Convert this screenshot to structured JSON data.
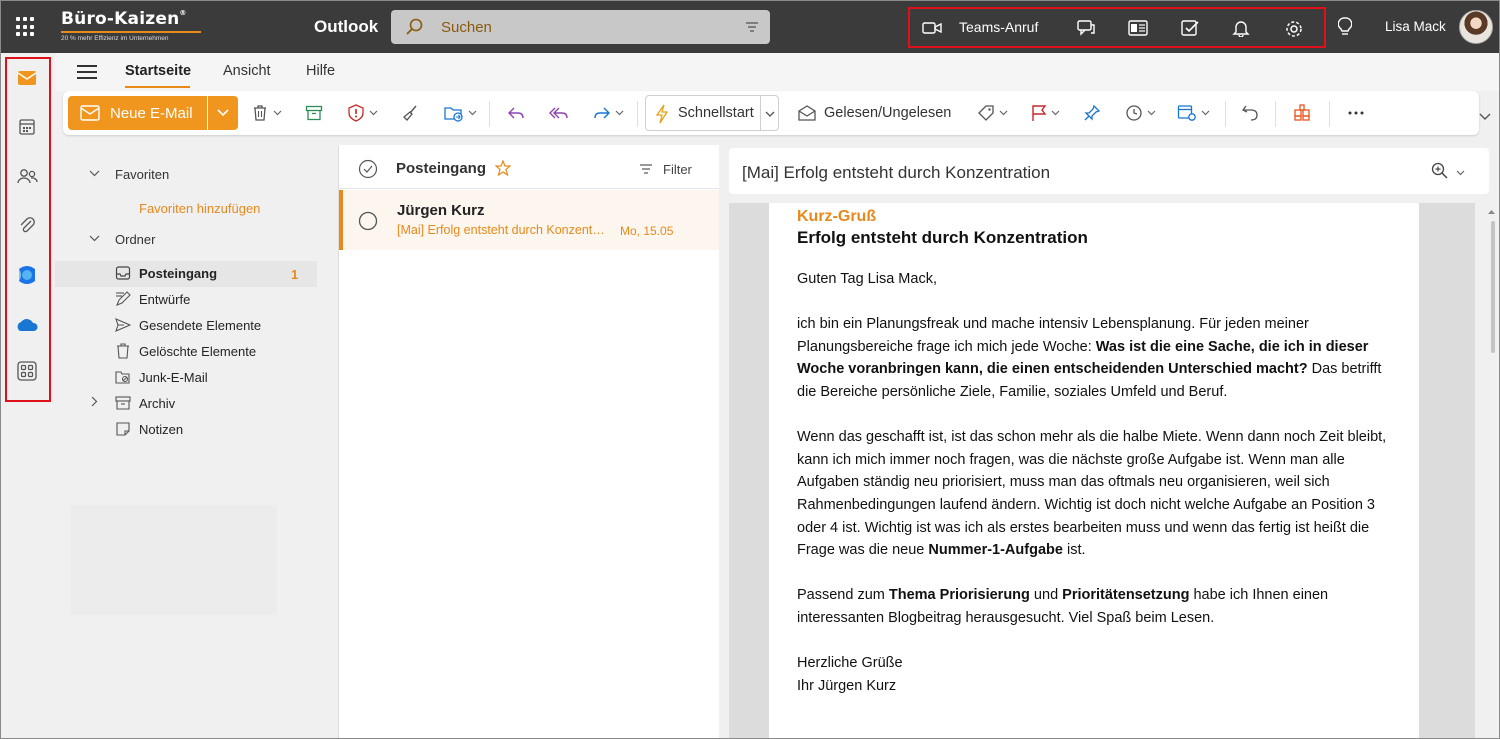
{
  "topbar": {
    "brand_name": "Büro-Kaizen",
    "brand_reg": "®",
    "brand_tagline": "20 % mehr Effizienz im Unternehmen",
    "app_name": "Outlook",
    "search_placeholder": "Suchen",
    "teams_label": "Teams-Anruf",
    "user_name": "Lisa Mack",
    "accent_color": "#e8891c",
    "highlight_color": "#e0101a",
    "icons": [
      "video-icon",
      "chat-icon",
      "notes-icon",
      "todo-icon",
      "bell-icon",
      "gear-icon",
      "lightbulb-icon"
    ]
  },
  "rail": {
    "items": [
      "mail-icon",
      "calendar-icon",
      "people-icon",
      "attachment-icon",
      "office-icon",
      "onedrive-icon",
      "apps-icon"
    ]
  },
  "ribbon": {
    "tabs": [
      {
        "label": "Startseite",
        "active": true
      },
      {
        "label": "Ansicht",
        "active": false
      },
      {
        "label": "Hilfe",
        "active": false
      }
    ],
    "new_mail_label": "Neue E-Mail",
    "quickstart_label": "Schnellstart",
    "read_unread_label": "Gelesen/Ungelesen"
  },
  "folders": {
    "favorites_label": "Favoriten",
    "add_favorites_label": "Favoriten hinzufügen",
    "folders_label": "Ordner",
    "items": [
      {
        "label": "Posteingang",
        "icon": "inbox-icon",
        "count": "1"
      },
      {
        "label": "Entwürfe",
        "icon": "draft-icon"
      },
      {
        "label": "Gesendete Elemente",
        "icon": "sent-icon"
      },
      {
        "label": "Gelöschte Elemente",
        "icon": "trash-icon"
      },
      {
        "label": "Junk-E-Mail",
        "icon": "junk-icon"
      },
      {
        "label": "Archiv",
        "icon": "archive-icon"
      },
      {
        "label": "Notizen",
        "icon": "note-icon"
      }
    ]
  },
  "message_list": {
    "title": "Posteingang",
    "filter_label": "Filter",
    "messages": [
      {
        "from": "Jürgen Kurz",
        "subject": "[Mai] Erfolg entsteht durch Konzentration",
        "date": "Mo, 15.05"
      }
    ]
  },
  "reading": {
    "title": "[Mai] Erfolg entsteht durch Konzentration",
    "kicker": "Kurz-Gruß",
    "heading": "Erfolg entsteht durch Konzentration",
    "greeting": "Guten Tag Lisa Mack,",
    "p1_a": "ich bin ein Planungsfreak und mache intensiv Lebensplanung. Für jeden meiner Planungsbereiche frage ich mich jede Woche: ",
    "p1_b": "Was ist die eine Sache, die ich in dieser Woche voranbringen kann, die einen entscheidenden Unterschied macht?",
    "p1_c": " Das betrifft die Bereiche persönliche Ziele, Familie, soziales Umfeld und Beruf.",
    "p2_a": "Wenn das geschafft ist, ist das schon mehr als die halbe Miete. Wenn dann noch Zeit bleibt, kann ich mich immer noch fragen, was die nächste große Aufgabe ist. Wenn man alle Aufgaben ständig neu priorisiert, muss man das oftmals neu organisieren, weil sich Rahmenbedingungen laufend ändern. Wichtig ist doch nicht welche Aufgabe an Position 3 oder 4 ist. Wichtig ist was ich als erstes bearbeiten muss und wenn das fertig ist heißt die Frage was die neue ",
    "p2_b": "Nummer-1-Aufgabe",
    "p2_c": " ist.",
    "p3_a": "Passend zum ",
    "p3_b": "Thema Priorisierung",
    "p3_c": " und ",
    "p3_d": "Prioritätensetzung",
    "p3_e": " habe ich Ihnen einen interessanten Blogbeitrag herausgesucht. Viel Spaß beim Lesen.",
    "closing1": "Herzliche Grüße",
    "closing2": "Ihr Jürgen Kurz"
  }
}
